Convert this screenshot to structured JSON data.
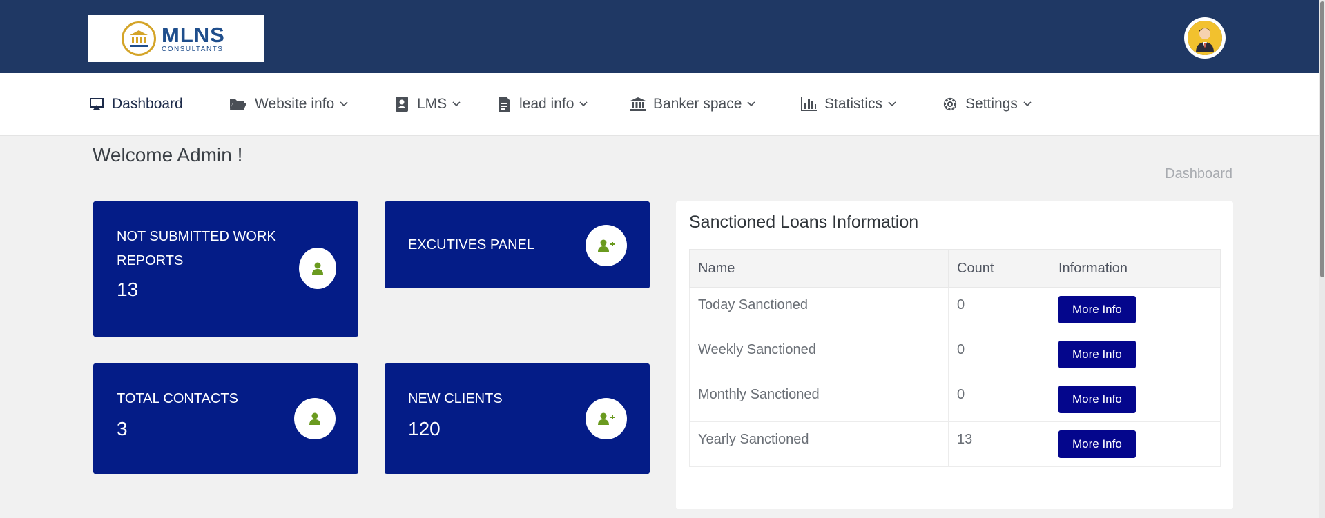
{
  "header": {
    "logo_main": "MLNS",
    "logo_sub": "CONSULTANTS",
    "brand_color": "#1f3864"
  },
  "nav": {
    "items": [
      {
        "label": "Dashboard",
        "icon": "monitor-icon",
        "dropdown": false
      },
      {
        "label": "Website info",
        "icon": "folder-icon",
        "dropdown": true
      },
      {
        "label": "LMS",
        "icon": "contacts-book-icon",
        "dropdown": true
      },
      {
        "label": "lead info",
        "icon": "document-icon",
        "dropdown": true
      },
      {
        "label": "Banker space",
        "icon": "bank-icon",
        "dropdown": true
      },
      {
        "label": "Statistics",
        "icon": "bar-chart-icon",
        "dropdown": true
      },
      {
        "label": "Settings",
        "icon": "gear-icon",
        "dropdown": true
      }
    ]
  },
  "page": {
    "welcome": "Welcome Admin !",
    "breadcrumb": "Dashboard"
  },
  "cards": {
    "not_submitted": {
      "title": "NOT SUBMITTED WORK REPORTS",
      "value": "13",
      "icon": "user-icon"
    },
    "executives": {
      "title": "EXCUTIVES PANEL",
      "icon": "user-plus-icon"
    },
    "total_contacts": {
      "title": "TOTAL CONTACTS",
      "value": "3",
      "icon": "user-icon"
    },
    "new_clients": {
      "title": "NEW CLIENTS",
      "value": "120",
      "icon": "user-plus-icon"
    },
    "card_color": "#041c87",
    "icon_color": "#6a9a1f"
  },
  "loans": {
    "title": "Sanctioned Loans Information",
    "columns": [
      "Name",
      "Count",
      "Information"
    ],
    "rows": [
      {
        "name": "Today Sanctioned",
        "count": "0",
        "button": "More Info"
      },
      {
        "name": "Weekly Sanctioned",
        "count": "0",
        "button": "More Info"
      },
      {
        "name": "Monthly Sanctioned",
        "count": "0",
        "button": "More Info"
      },
      {
        "name": "Yearly Sanctioned",
        "count": "13",
        "button": "More Info"
      }
    ],
    "button_color": "#04068c"
  }
}
